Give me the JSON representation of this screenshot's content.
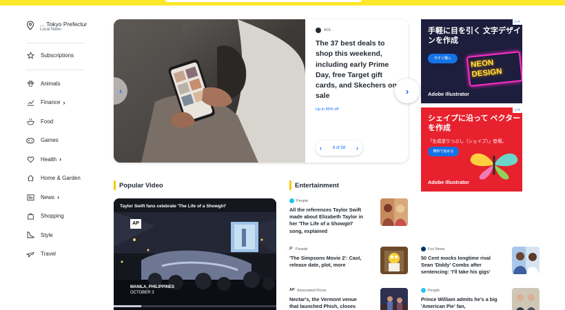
{
  "sidebar": {
    "location": {
      "name": "... Tokyo Prefectur",
      "sub": "Local News"
    },
    "items": [
      {
        "label": "Subscriptions",
        "icon": "star-icon",
        "has_chevron": false
      },
      {
        "label": "Animals",
        "icon": "paw-icon",
        "has_chevron": false
      },
      {
        "label": "Finance",
        "icon": "chart-icon",
        "has_chevron": true
      },
      {
        "label": "Food",
        "icon": "bowl-icon",
        "has_chevron": false
      },
      {
        "label": "Games",
        "icon": "gamepad-icon",
        "has_chevron": false
      },
      {
        "label": "Health",
        "icon": "heart-icon",
        "has_chevron": true
      },
      {
        "label": "Home & Garden",
        "icon": "house-icon",
        "has_chevron": false
      },
      {
        "label": "News",
        "icon": "newspaper-icon",
        "has_chevron": true
      },
      {
        "label": "Shopping",
        "icon": "bag-icon",
        "has_chevron": false
      },
      {
        "label": "Style",
        "icon": "shoe-icon",
        "has_chevron": false
      },
      {
        "label": "Travel",
        "icon": "plane-icon",
        "has_chevron": false
      }
    ]
  },
  "hero": {
    "source": "AOL",
    "title": "The 37 best deals to shop this weekend, including early Prime Day, free Target gift cards, and Skechers on sale",
    "subtitle": "Up to 85% off",
    "pager": "8 of 58"
  },
  "ads": {
    "ad1": {
      "headline": "手軽に目を引く 文字デザインを作成",
      "button": "今すぐ購入",
      "brand": "Adobe Illustrator",
      "neon": "NEON DESIGN"
    },
    "ad2": {
      "headline": "シェイプに沿って ベクターを作成",
      "sub": "「生成塗りつぶし（シェイプ）」登場。",
      "button": "無料で始める",
      "brand": "Adobe Illustrator"
    }
  },
  "popular_video": {
    "header": "Popular Video",
    "title": "Taylor Swift fans celebrate 'The Life of a Showgirl'",
    "overlay_logo": "AP",
    "location": "MANILA, PHILIPPINES",
    "date": "OCTOBER 3"
  },
  "entertainment": {
    "header": "Entertainment",
    "articles": [
      {
        "source": "People",
        "title": "All the references Taylor Swift made about Elizabeth Taylor in her 'The Life of a Showgirl' song, explained"
      },
      {
        "source": "Parade",
        "title": "'The Simpsons Movie 2': Cast, release date, plot, more"
      },
      {
        "source": "Associated Press",
        "title": "Nectar's, the Vermont venue that launched Phish, closes"
      },
      {
        "source": "Fox News",
        "title": "50 Cent mocks longtime rival Sean 'Diddy' Combs after sentencing: 'I'll take his gigs'"
      },
      {
        "source": "People",
        "title": "Prince William admits he's a big 'American Pie' fan,"
      }
    ]
  },
  "colors": {
    "accent_yellow": "#fce72a",
    "link_blue": "#0f69ff",
    "section_bar": "#fbc900",
    "ad_red": "#e8212e"
  }
}
